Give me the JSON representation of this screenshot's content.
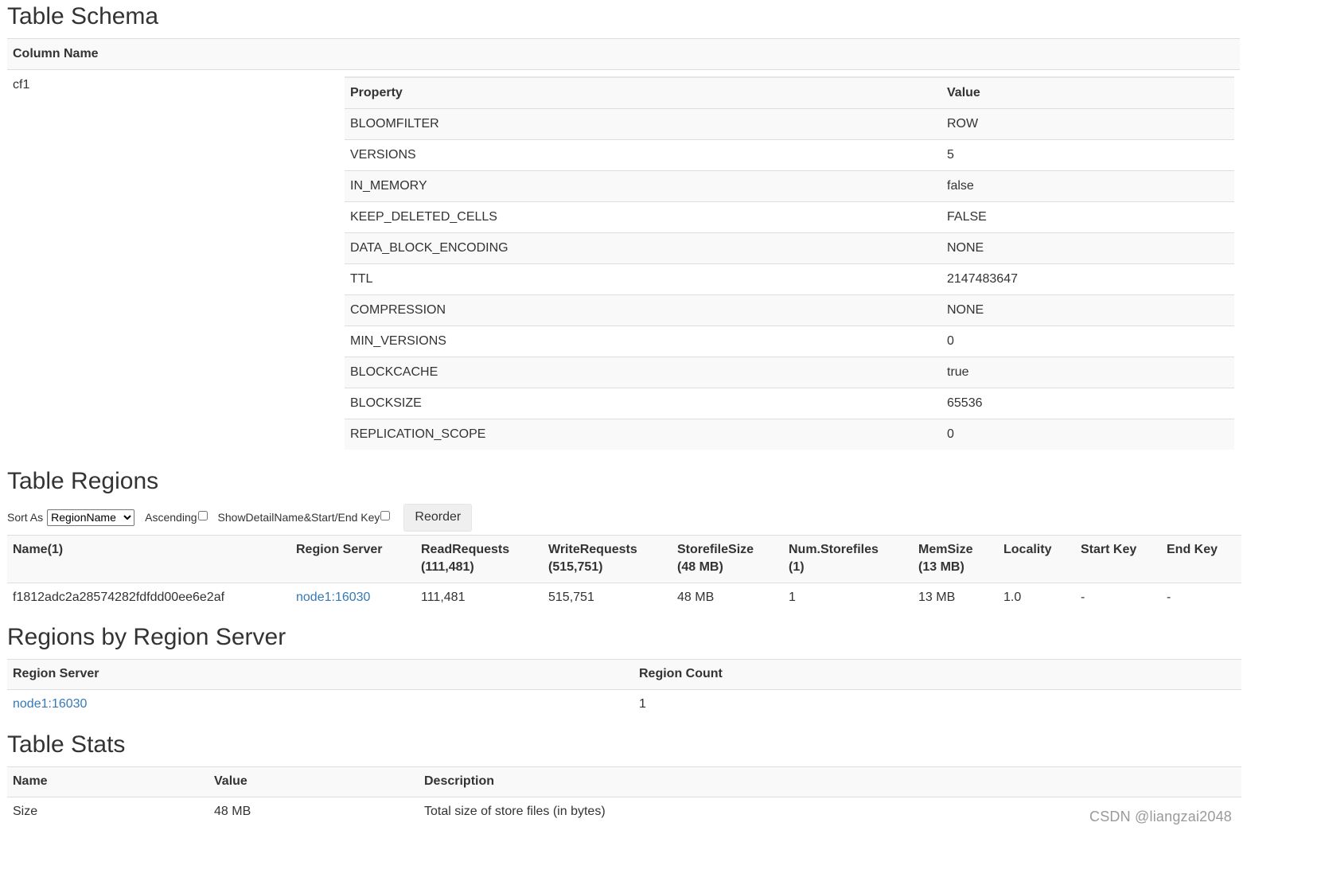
{
  "schema": {
    "title": "Table Schema",
    "column_header": "Column Name",
    "columns": [
      {
        "name": "cf1",
        "property_header": "Property",
        "value_header": "Value",
        "properties": [
          {
            "name": "BLOOMFILTER",
            "value": "ROW"
          },
          {
            "name": "VERSIONS",
            "value": "5"
          },
          {
            "name": "IN_MEMORY",
            "value": "false"
          },
          {
            "name": "KEEP_DELETED_CELLS",
            "value": "FALSE"
          },
          {
            "name": "DATA_BLOCK_ENCODING",
            "value": "NONE"
          },
          {
            "name": "TTL",
            "value": "2147483647"
          },
          {
            "name": "COMPRESSION",
            "value": "NONE"
          },
          {
            "name": "MIN_VERSIONS",
            "value": "0"
          },
          {
            "name": "BLOCKCACHE",
            "value": "true"
          },
          {
            "name": "BLOCKSIZE",
            "value": "65536"
          },
          {
            "name": "REPLICATION_SCOPE",
            "value": "0"
          }
        ]
      }
    ]
  },
  "regions": {
    "title": "Table Regions",
    "sort_as_label": "Sort As",
    "sort_selected": "RegionName",
    "ascending_label": "Ascending",
    "show_detail_label": "ShowDetailName&Start/End Key",
    "reorder_label": "Reorder",
    "headers": [
      {
        "line1": "Name(1)",
        "line2": ""
      },
      {
        "line1": "Region Server",
        "line2": ""
      },
      {
        "line1": "ReadRequests",
        "line2": "(111,481)"
      },
      {
        "line1": "WriteRequests",
        "line2": "(515,751)"
      },
      {
        "line1": "StorefileSize",
        "line2": "(48 MB)"
      },
      {
        "line1": "Num.Storefiles",
        "line2": "(1)"
      },
      {
        "line1": "MemSize",
        "line2": "(13 MB)"
      },
      {
        "line1": "Locality",
        "line2": ""
      },
      {
        "line1": "Start Key",
        "line2": ""
      },
      {
        "line1": "End Key",
        "line2": ""
      }
    ],
    "rows": [
      {
        "name": "f1812adc2a28574282fdfdd00ee6e2af",
        "region_server": "node1:16030",
        "read_requests": "111,481",
        "write_requests": "515,751",
        "storefile_size": "48 MB",
        "num_storefiles": "1",
        "mem_size": "13 MB",
        "locality": "1.0",
        "start_key": "-",
        "end_key": "-"
      }
    ]
  },
  "regions_by_server": {
    "title": "Regions by Region Server",
    "headers": [
      "Region Server",
      "Region Count"
    ],
    "rows": [
      {
        "server": "node1:16030",
        "count": "1"
      }
    ]
  },
  "stats": {
    "title": "Table Stats",
    "headers": [
      "Name",
      "Value",
      "Description"
    ],
    "rows": [
      {
        "name": "Size",
        "value": "48 MB",
        "description": "Total size of store files (in bytes)"
      }
    ]
  },
  "watermark": "CSDN @liangzai2048",
  "colors": {
    "link": "#337ab7",
    "stripe": "#f9f9f9",
    "border": "#dddddd"
  }
}
